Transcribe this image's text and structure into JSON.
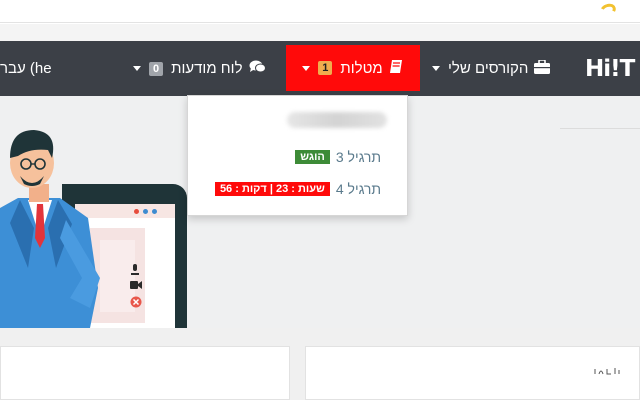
{
  "nav": {
    "logo": "Hi!T",
    "courses_label": "הקורסים שלי",
    "tasks_label": "מטלות",
    "tasks_count": "1",
    "board_label": "לוח מודעות",
    "board_count": "0",
    "language_label": "עברית (he"
  },
  "dropdown": {
    "items": [
      {
        "label": "תרגיל 3",
        "tag": "הוגש"
      },
      {
        "label": "תרגיל 4",
        "tag": "שעות : 23 | דקות : 56"
      }
    ]
  },
  "colors": {
    "navbar": "#3c4047",
    "tasks_active": "#ff0a0a",
    "submitted_tag": "#3d8b37",
    "countdown_tag": "#ff0a0a",
    "badge_orange": "#f0ad4e",
    "badge_gray": "#a0a4aa"
  },
  "icons": {
    "courses": "briefcase-icon",
    "tasks": "book-icon",
    "board": "comments-icon"
  }
}
